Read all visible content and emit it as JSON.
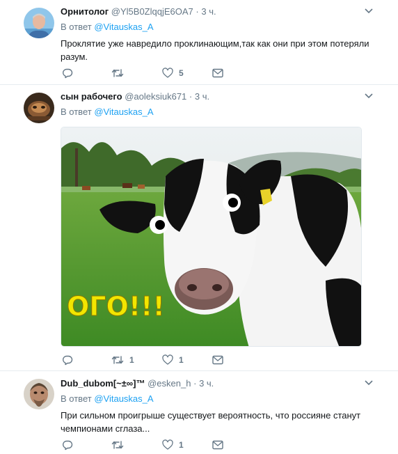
{
  "tweets": [
    {
      "name": "Орнитолог",
      "handle": "@Yl5B0ZlqqjE6OA7",
      "dot": "·",
      "time": "3 ч.",
      "reply_prefix": "В ответ",
      "reply_to": "@Vitauskas_A",
      "text": "Проклятие уже навредило проклинающим,так как они при этом потеряли разум.",
      "retweets": "",
      "likes": "5"
    },
    {
      "name": "сын рабочего",
      "handle": "@aoleksiuk671",
      "dot": "·",
      "time": "3 ч.",
      "reply_prefix": "В ответ",
      "reply_to": "@Vitauskas_A",
      "image_caption": "ОГО!!!",
      "retweets": "1",
      "likes": "1"
    },
    {
      "name": "Dub_dubom[~±∞]™",
      "handle": "@esken_h",
      "dot": "·",
      "time": "3 ч.",
      "reply_prefix": "В ответ",
      "reply_to": "@Vitauskas_A",
      "text": "При сильном проигрыше существует вероятность, что россияне станут чемпионами сглаза...",
      "retweets": "",
      "likes": "1"
    }
  ],
  "colors": {
    "link": "#1da1f2",
    "secondary": "#657786",
    "divider": "#e6ecf0",
    "caption_yellow": "#f2e600"
  },
  "icons": [
    "reply-icon",
    "retweet-icon",
    "like-icon",
    "message-icon",
    "chevron-down-icon"
  ]
}
